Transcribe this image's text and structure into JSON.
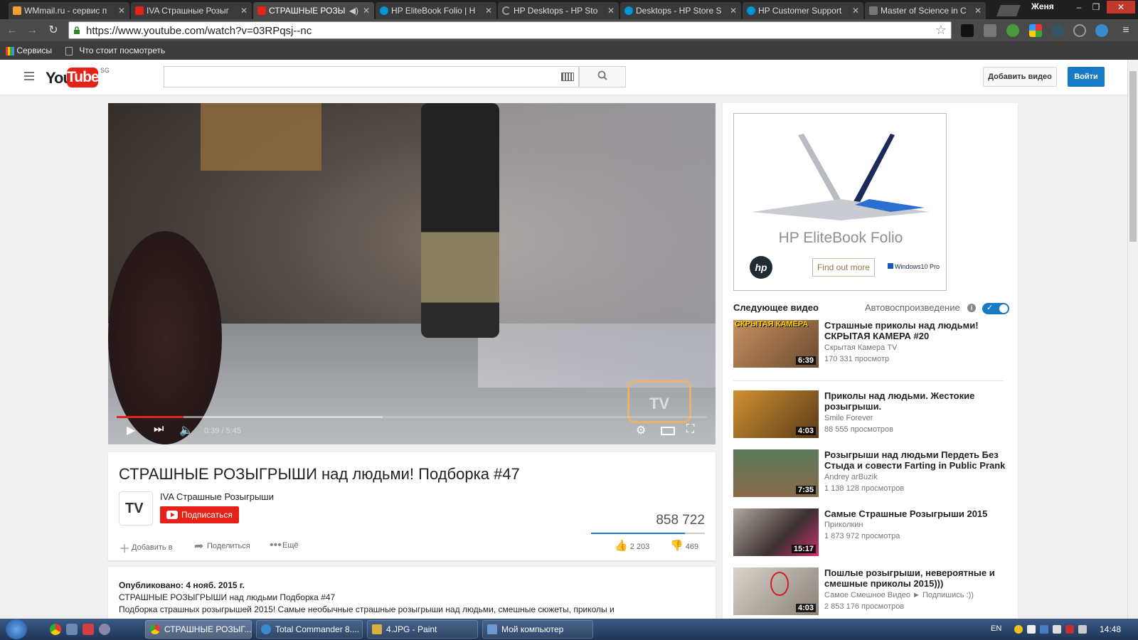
{
  "browser": {
    "tabs": [
      {
        "title": "WMmail.ru - сервис п",
        "color": "#f0a030",
        "active": false
      },
      {
        "title": "IVA Страшные Розыг",
        "color": "#e62117",
        "active": false
      },
      {
        "title": "СТРАШНЫЕ РОЗЫ",
        "color": "#e62117",
        "active": true
      },
      {
        "title": "HP EliteBook Folio | H",
        "color": "#0096d6",
        "active": false
      },
      {
        "title": "HP Desktops - HP Sto",
        "color": "#999999",
        "active": false
      },
      {
        "title": "Desktops - HP Store S",
        "color": "#0096d6",
        "active": false
      },
      {
        "title": "HP Customer Support",
        "color": "#0096d6",
        "active": false
      },
      {
        "title": "Master of Science in C",
        "color": "#777777",
        "active": false
      }
    ],
    "profile_name": "Женя",
    "url": "https://www.youtube.com/watch?v=03RPqsj--nc",
    "bookmarks": [
      {
        "label": "Сервисы"
      },
      {
        "label": "Что стоит посмотреть"
      }
    ]
  },
  "youtube": {
    "logo_you": "You",
    "logo_tube": "Tube",
    "region": "SG",
    "search_placeholder": "",
    "upload_label": "Добавить видео",
    "signin_label": "Войти"
  },
  "player": {
    "time": "0:39 / 5:45",
    "progress_fraction": 0.113,
    "watermark": "TV"
  },
  "video": {
    "title": "СТРАШНЫЕ РОЗЫГРЫШИ над людьми! Подборка #47",
    "channel": "IVA Страшные Розыгрыши",
    "channel_avatar_text": "TV",
    "subscribe_label": "Подписаться",
    "views": "858 722",
    "likes": "2 203",
    "dislikes": "469",
    "like_fraction": 0.824,
    "actions": {
      "add": "Добавить в",
      "share": "Поделиться",
      "more": "Ещё"
    }
  },
  "description": {
    "published": "Опубликовано: 4 нояб. 2015 г.",
    "line1": "СТРАШНЫЕ РОЗЫГРЫШИ над людьми Подборка #47",
    "line2": "Подборка страшных розыгрышей 2015! Самые необычные страшные розыгрыши над людьми, смешные сюжеты, приколы и"
  },
  "ad": {
    "title": "HP EliteBook Folio",
    "logo": "hp",
    "button": "Find out more",
    "windows": "Windows10 Pro"
  },
  "sidebar": {
    "next_label": "Следующее видео",
    "autoplay_label": "Автовоспроизведение",
    "related": [
      {
        "title": "Страшные приколы над людьми! СКРЫТАЯ КАМЕРА #20",
        "channel": "Скрытая Камера TV",
        "views": "170 331 просмотр",
        "duration": "6:39",
        "thumb_text": "СКРЫТАЯ КАМЕРА"
      },
      {
        "title": "Приколы над людьми. Жестокие розыгрыши.",
        "channel": "Smile Forever",
        "views": "88 555 просмотров",
        "duration": "4:03",
        "thumb_text": ""
      },
      {
        "title": "Розыгрыши над людьми Пердеть Без Стыда и совести Farting in Public Prank [",
        "channel": "Andrey arBuzik",
        "views": "1 138 128 просмотров",
        "duration": "7:35",
        "thumb_text": ""
      },
      {
        "title": "Самые Страшные Розыгрыши 2015",
        "channel": "Приколкин",
        "views": "1 873 972 просмотра",
        "duration": "15:17",
        "thumb_text": ""
      },
      {
        "title": "Пошлые розыгрыши, невероятные и смешные приколы 2015)))",
        "channel": "Самое Смешное Видео ► Подпишись :))",
        "views": "2 853 176 просмотров",
        "duration": "4:03",
        "thumb_text": ""
      }
    ]
  },
  "taskbar": {
    "tasks": [
      {
        "label": "СТРАШНЫЕ РОЗЫГ...",
        "active": true
      },
      {
        "label": "Total Commander 8....",
        "active": false
      },
      {
        "label": "4.JPG - Paint",
        "active": false
      },
      {
        "label": "Мой компьютер",
        "active": false
      }
    ],
    "language": "EN",
    "clock": "14:48"
  },
  "colors": {
    "brand": "#e62117",
    "accent": "#167ac6"
  }
}
